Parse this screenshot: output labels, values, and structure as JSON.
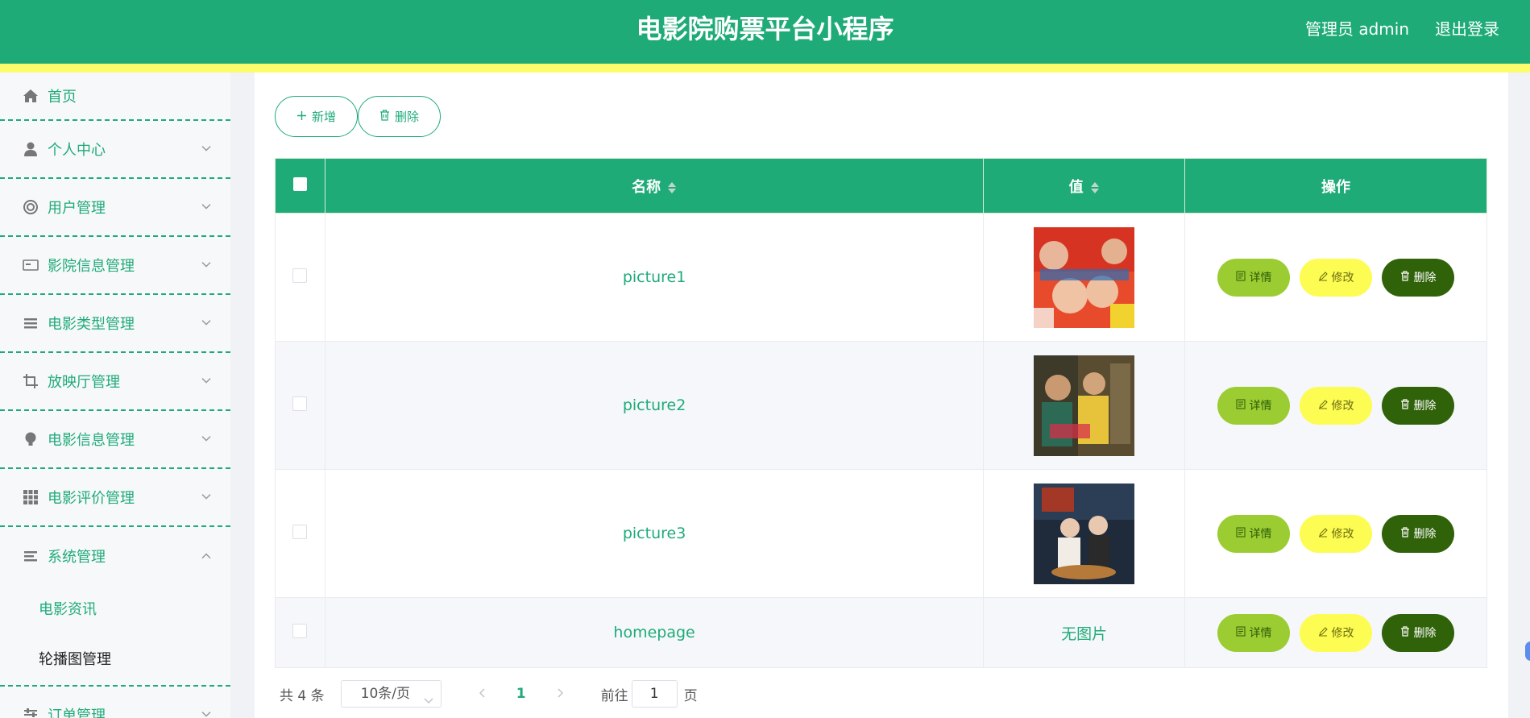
{
  "header": {
    "title": "电影院购票平台小程序",
    "user": "管理员 admin",
    "logout": "退出登录"
  },
  "sidebar": {
    "items": [
      {
        "label": "首页",
        "icon": "home-icon"
      },
      {
        "label": "个人中心",
        "icon": "user-icon"
      },
      {
        "label": "用户管理",
        "icon": "lifebuoy-icon"
      },
      {
        "label": "影院信息管理",
        "icon": "card-icon"
      },
      {
        "label": "电影类型管理",
        "icon": "list-icon"
      },
      {
        "label": "放映厅管理",
        "icon": "crop-icon"
      },
      {
        "label": "电影信息管理",
        "icon": "bulb-icon"
      },
      {
        "label": "电影评价管理",
        "icon": "grid-icon"
      },
      {
        "label": "系统管理",
        "icon": "menu-icon"
      },
      {
        "label": "订单管理",
        "icon": "sliders-icon"
      }
    ],
    "submenu": [
      {
        "label": "电影资讯"
      },
      {
        "label": "轮播图管理"
      }
    ]
  },
  "toolbar": {
    "add_label": "新增",
    "delete_label": "删除"
  },
  "table": {
    "columns": [
      "名称",
      "值",
      "操作"
    ],
    "rows": [
      {
        "name": "picture1",
        "value": ""
      },
      {
        "name": "picture2",
        "value": ""
      },
      {
        "name": "picture3",
        "value": ""
      },
      {
        "name": "homepage",
        "value": "无图片"
      }
    ],
    "actions": {
      "detail": "详情",
      "edit": "修改",
      "delete": "删除"
    }
  },
  "pager": {
    "total": "共 4 条",
    "page_size": "10条/页",
    "current": "1",
    "goto_label": "前往",
    "goto_value": "1",
    "page_unit": "页"
  },
  "colors": {
    "primary": "#1fab78",
    "accent_bar": "#fdfc6b",
    "detail": "#9bcc32",
    "edit": "#fdfc52",
    "delete": "#2f6209"
  }
}
